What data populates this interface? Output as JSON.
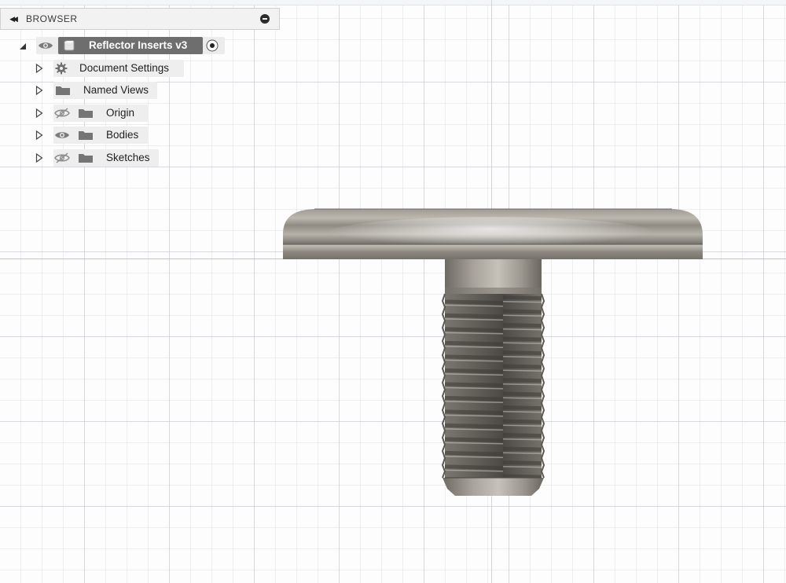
{
  "browser": {
    "title": "BROWSER",
    "root": {
      "label": "Reflector Inserts v3",
      "icon": "component-icon"
    },
    "items": [
      {
        "label": "Document Settings",
        "icon": "gear-icon",
        "visibility": "none"
      },
      {
        "label": "Named Views",
        "icon": "folder-icon",
        "visibility": "none"
      },
      {
        "label": "Origin",
        "icon": "folder-icon",
        "visibility": "hidden"
      },
      {
        "label": "Bodies",
        "icon": "folder-icon",
        "visibility": "visible"
      },
      {
        "label": "Sketches",
        "icon": "folder-icon",
        "visibility": "hidden"
      }
    ]
  },
  "colors": {
    "selected_pill": "#6e6e6e",
    "row_pill": "#eeeeee",
    "axis_x": "#f3b1b1",
    "metal": "#8c877f"
  }
}
